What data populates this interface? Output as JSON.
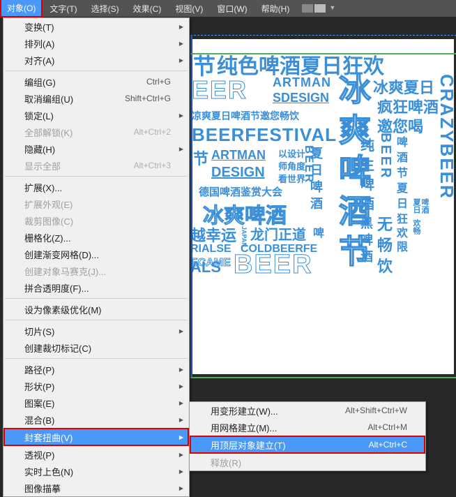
{
  "menubar": {
    "items": [
      "对象(O)",
      "文字(T)",
      "选择(S)",
      "效果(C)",
      "视图(V)",
      "窗口(W)",
      "帮助(H)"
    ],
    "activeIndex": 0
  },
  "dropdown": [
    {
      "label": "变换(T)",
      "arrow": true
    },
    {
      "label": "排列(A)",
      "arrow": true
    },
    {
      "label": "对齐(A)",
      "arrow": true
    },
    {
      "sep": true
    },
    {
      "label": "编组(G)",
      "sc": "Ctrl+G"
    },
    {
      "label": "取消编组(U)",
      "sc": "Shift+Ctrl+G"
    },
    {
      "label": "锁定(L)",
      "arrow": true
    },
    {
      "label": "全部解锁(K)",
      "sc": "Alt+Ctrl+2",
      "disabled": true
    },
    {
      "label": "隐藏(H)",
      "arrow": true
    },
    {
      "label": "显示全部",
      "sc": "Alt+Ctrl+3",
      "disabled": true
    },
    {
      "sep": true
    },
    {
      "label": "扩展(X)..."
    },
    {
      "label": "扩展外观(E)",
      "disabled": true
    },
    {
      "label": "裁剪图像(C)",
      "disabled": true
    },
    {
      "label": "栅格化(Z)..."
    },
    {
      "label": "创建渐变网格(D)..."
    },
    {
      "label": "创建对象马赛克(J)...",
      "disabled": true
    },
    {
      "label": "拼合透明度(F)..."
    },
    {
      "sep": true
    },
    {
      "label": "设为像素级优化(M)"
    },
    {
      "sep": true
    },
    {
      "label": "切片(S)",
      "arrow": true
    },
    {
      "label": "创建裁切标记(C)"
    },
    {
      "sep": true
    },
    {
      "label": "路径(P)",
      "arrow": true
    },
    {
      "label": "形状(P)",
      "arrow": true
    },
    {
      "label": "图案(E)",
      "arrow": true
    },
    {
      "label": "混合(B)",
      "arrow": true
    },
    {
      "label": "封套扭曲(V)",
      "arrow": true,
      "hl": true
    },
    {
      "label": "透视(P)",
      "arrow": true
    },
    {
      "label": "实时上色(N)",
      "arrow": true
    },
    {
      "label": "图像描摹",
      "arrow": true
    }
  ],
  "submenu": [
    {
      "label": "用变形建立(W)...",
      "sc": "Alt+Shift+Ctrl+W"
    },
    {
      "label": "用网格建立(M)...",
      "sc": "Alt+Ctrl+M"
    },
    {
      "label": "用顶层对象建立(T)",
      "sc": "Alt+Ctrl+C",
      "hl": true
    },
    {
      "label": "释放(R)",
      "disabled": true
    }
  ],
  "canvas": {
    "t1": "节",
    "t2": "纯色啤酒夏日狂欢",
    "t3": "EER",
    "t4": "ARTMAN",
    "t5": "冰爽夏日",
    "t6": "SDESIGN",
    "t7": "疯狂啤酒",
    "t8": "凉爽夏日啤酒节邀您畅饮",
    "t9": "邀您喝",
    "t10": "BEERFESTIVAL",
    "t11": "冰",
    "t12": "CRAZYBEER",
    "t13": "节",
    "t14": "ARTMAN",
    "t15": "以设计",
    "t16": "夏",
    "t17": "DESIGN",
    "t18": "师角度",
    "t19": "日",
    "t20": "看世界",
    "t21": "BEER",
    "t22": "德国啤酒鉴赏大会",
    "t23": "啤",
    "t24": "冰爽啤酒",
    "t25": "酒",
    "t26": "越幸运",
    "t27": "JAPAN",
    "t28": "龙门正道",
    "t29": "啤",
    "t30": "RIALSE",
    "t31": "COLDBEERFE",
    "t32": "爽",
    "t33": "啤",
    "t34": "酒",
    "t35": "节",
    "t36": "ECAME",
    "t37": "ALS",
    "t38": "BEER",
    "t39": "纯",
    "t40": "生",
    "t41": "啤",
    "t42": "酒",
    "t43": "BEER",
    "t44": "啤",
    "t45": "酒",
    "t46": "节",
    "t47": "夏",
    "t48": "日",
    "t49": "狂",
    "t50": "欢",
    "t51": "限",
    "t52": "夏日",
    "t53": "啤酒",
    "t54": "欢畅",
    "t55": "黑",
    "t56": "啤",
    "t57": "酒",
    "t58": "无",
    "t59": "畅",
    "t60": "饮"
  }
}
